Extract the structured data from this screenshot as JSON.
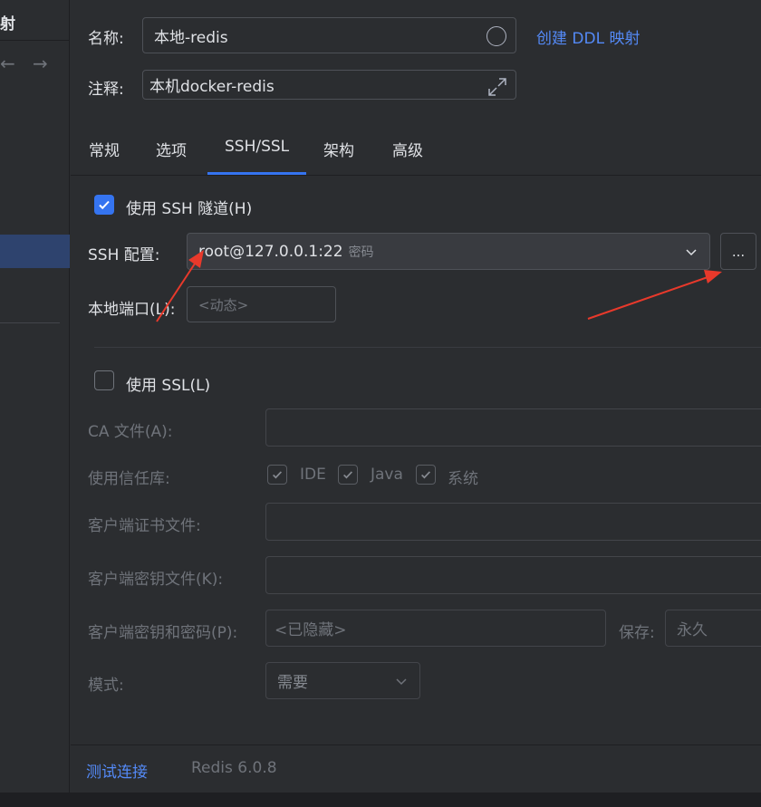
{
  "left_panel": {
    "title_fragment": "射",
    "back_arrow": "←",
    "forward_arrow": "→"
  },
  "form": {
    "name_label": "名称:",
    "name_value": "本地-redis",
    "create_ddl_link": "创建 DDL 映射",
    "comment_label": "注释:",
    "comment_value": "本机docker-redis"
  },
  "tabs": [
    {
      "label": "常规",
      "active": false
    },
    {
      "label": "选项",
      "active": false
    },
    {
      "label": "SSH/SSL",
      "active": true
    },
    {
      "label": "架构",
      "active": false
    },
    {
      "label": "高级",
      "active": false
    }
  ],
  "ssh": {
    "use_ssh_label": "使用 SSH 隧道(H)",
    "use_ssh_checked": true,
    "config_label": "SSH 配置:",
    "config_value": "root@127.0.0.1:22",
    "config_auth": "密码",
    "more_button": "...",
    "local_port_label": "本地端口(L):",
    "local_port_placeholder": "<动态>"
  },
  "ssl": {
    "use_ssl_label": "使用 SSL(L)",
    "use_ssl_checked": false,
    "ca_file_label": "CA 文件(A):",
    "truststore_label": "使用信任库:",
    "truststore_options": [
      "IDE",
      "Java",
      "系统"
    ],
    "client_cert_label": "客户端证书文件:",
    "client_key_label": "客户端密钥文件(K):",
    "client_key_password_label": "客户端密钥和密码(P):",
    "client_key_password_value": "<已隐藏>",
    "save_label": "保存:",
    "save_value": "永久",
    "mode_label": "模式:",
    "mode_value": "需要"
  },
  "footer": {
    "test_connection": "测试连接",
    "version": "Redis 6.0.8"
  },
  "colors": {
    "accent": "#3574f0",
    "link": "#548af7",
    "annotation_arrow": "#e8392b"
  },
  "annotations": [
    "red-arrow-to-ssh-config",
    "red-arrow-to-more-button"
  ]
}
